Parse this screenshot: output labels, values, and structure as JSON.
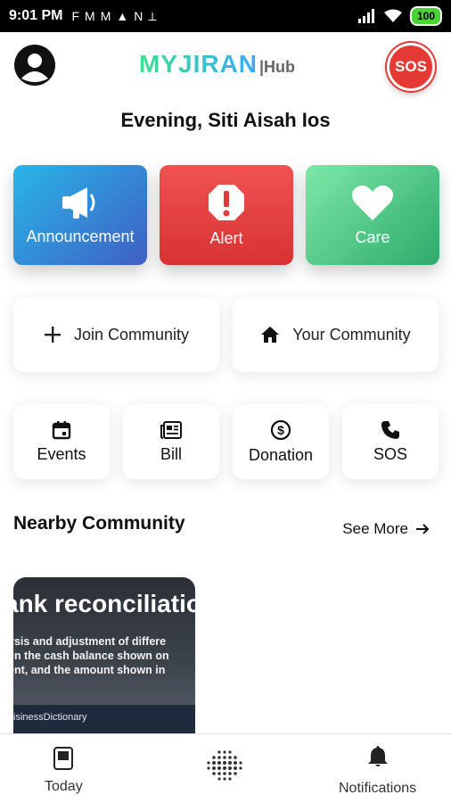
{
  "status_bar": {
    "time": "9:01 PM",
    "notification_icons": [
      "F",
      "M",
      "M",
      "▲",
      "N",
      "⟂"
    ],
    "battery": "100"
  },
  "header": {
    "logo_brand": "MYJIRAN",
    "logo_suffix": "|Hub",
    "sos_label": "SOS"
  },
  "greeting": "Evening, Siti Aisah Ios",
  "quick_tiles": [
    {
      "label": "Announcement",
      "icon": "megaphone-icon"
    },
    {
      "label": "Alert",
      "icon": "alert-icon"
    },
    {
      "label": "Care",
      "icon": "heart-icon"
    }
  ],
  "community_actions": [
    {
      "label": "Join Community",
      "icon": "plus-icon"
    },
    {
      "label": "Your Community",
      "icon": "home-icon"
    }
  ],
  "shortcuts": [
    {
      "label": "Events",
      "icon": "calendar-icon"
    },
    {
      "label": "Bill",
      "icon": "newspaper-icon"
    },
    {
      "label": "Donation",
      "icon": "dollar-circle-icon"
    },
    {
      "label": "SOS",
      "icon": "phone-icon"
    }
  ],
  "nearby": {
    "title": "Nearby Community",
    "see_more": "See More",
    "card": {
      "title": "ank reconciliatio",
      "desc_line1": "ysis and adjustment of differe",
      "desc_line2": "en the cash balance shown on",
      "desc_line3": "ent, and the amount shown in",
      "footer": "isinessDictionary"
    }
  },
  "bottom_nav": {
    "today": "Today",
    "notifications": "Notifications"
  }
}
